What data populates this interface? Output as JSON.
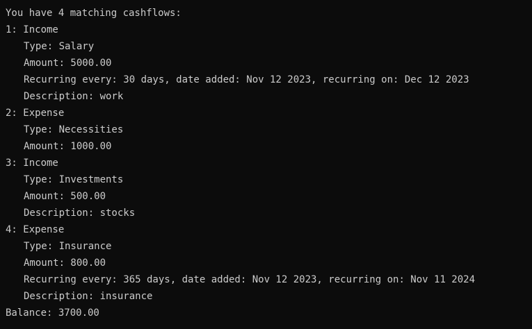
{
  "terminal": {
    "header": "You have 4 matching cashflows:",
    "cashflows": [
      {
        "title": "1: Income",
        "type": "Type: Salary",
        "amount": "Amount: 5000.00",
        "recurring": "Recurring every: 30 days, date added: Nov 12 2023, recurring on: Dec 12 2023",
        "description": "Description: work"
      },
      {
        "title": "2: Expense",
        "type": "Type: Necessities",
        "amount": "Amount: 1000.00"
      },
      {
        "title": "3: Income",
        "type": "Type: Investments",
        "amount": "Amount: 500.00",
        "description": "Description: stocks"
      },
      {
        "title": "4: Expense",
        "type": "Type: Insurance",
        "amount": "Amount: 800.00",
        "recurring": "Recurring every: 365 days, date added: Nov 12 2023, recurring on: Nov 11 2024",
        "description": "Description: insurance"
      }
    ],
    "balance": "Balance: 3700.00"
  },
  "colors": {
    "background": "#0c0c0c",
    "text": "#cccccc"
  }
}
